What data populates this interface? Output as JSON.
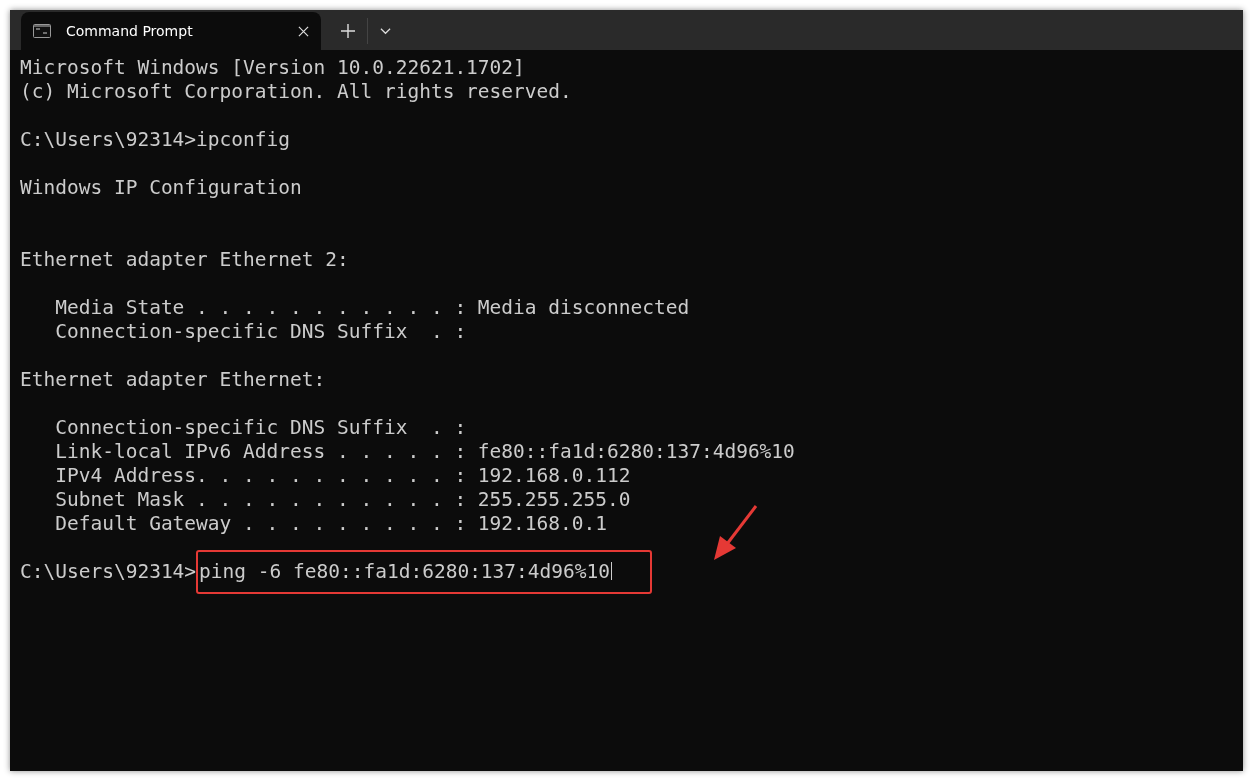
{
  "tabs": [
    {
      "title": "Command Prompt",
      "selected": true
    }
  ],
  "terminal": {
    "lines": [
      {
        "kind": "text",
        "text": "Microsoft Windows [Version 10.0.22621.1702]"
      },
      {
        "kind": "text",
        "text": "(c) Microsoft Corporation. All rights reserved."
      },
      {
        "kind": "blank"
      },
      {
        "kind": "text",
        "text": "C:\\Users\\92314>ipconfig"
      },
      {
        "kind": "blank"
      },
      {
        "kind": "text",
        "text": "Windows IP Configuration"
      },
      {
        "kind": "blank"
      },
      {
        "kind": "blank"
      },
      {
        "kind": "text",
        "text": "Ethernet adapter Ethernet 2:"
      },
      {
        "kind": "blank"
      },
      {
        "kind": "text",
        "text": "   Media State . . . . . . . . . . . : Media disconnected"
      },
      {
        "kind": "text",
        "text": "   Connection-specific DNS Suffix  . :"
      },
      {
        "kind": "blank"
      },
      {
        "kind": "text",
        "text": "Ethernet adapter Ethernet:"
      },
      {
        "kind": "blank"
      },
      {
        "kind": "text",
        "text": "   Connection-specific DNS Suffix  . :"
      },
      {
        "kind": "text",
        "text": "   Link-local IPv6 Address . . . . . : fe80::fa1d:6280:137:4d96%10"
      },
      {
        "kind": "text",
        "text": "   IPv4 Address. . . . . . . . . . . : 192.168.0.112"
      },
      {
        "kind": "text",
        "text": "   Subnet Mask . . . . . . . . . . . : 255.255.255.0"
      },
      {
        "kind": "text",
        "text": "   Default Gateway . . . . . . . . . : 192.168.0.1"
      },
      {
        "kind": "blank"
      },
      {
        "kind": "input",
        "prompt": "C:\\Users\\92314>",
        "command": "ping -6 fe80::fa1d:6280:137:4d96%10",
        "highlighted": true
      }
    ]
  }
}
